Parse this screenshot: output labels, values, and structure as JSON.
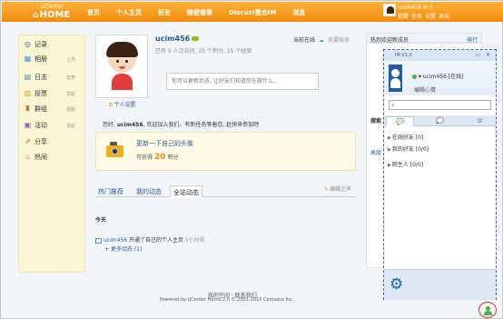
{
  "colors": {
    "accent": "#f08c0d",
    "link": "#2b5c9c",
    "im_blue": "#1e5ea8"
  },
  "logo": {
    "top": "UCenter",
    "home": "HOME"
  },
  "nav": [
    "首页",
    "个人主页",
    "好友",
    "随便看看",
    "Discuz!整合IM",
    "消息"
  ],
  "user_top": {
    "name": "ucim456",
    "badge": "✉ 3",
    "links": [
      "提醒",
      "任务",
      "设置",
      "退出"
    ]
  },
  "sidebar": [
    {
      "icon": "record-icon",
      "glyph": "◎",
      "label": "记录",
      "extra": ""
    },
    {
      "icon": "album-icon",
      "glyph": "▦",
      "label": "相册",
      "extra": "上传"
    },
    {
      "icon": "blog-icon",
      "glyph": "▤",
      "label": "日志",
      "extra": "发表"
    },
    {
      "icon": "poll-icon",
      "glyph": "▥",
      "label": "投票",
      "extra": "发起"
    },
    {
      "icon": "group-icon",
      "glyph": "♜",
      "label": "群组",
      "extra": "话题"
    },
    {
      "icon": "event-icon",
      "glyph": "▣",
      "label": "活动",
      "extra": "发起"
    },
    {
      "icon": "share-icon",
      "glyph": "⇗",
      "label": "分享",
      "extra": ""
    },
    {
      "icon": "hot-icon",
      "glyph": "♨",
      "label": "热闹",
      "extra": ""
    }
  ],
  "profile": {
    "username": "ucim456",
    "stats": "已有 0 人次访问, 25 个积分, 15 个经验",
    "settings_link": "个人设置",
    "online": "当前在线",
    "hide_label": "隐身",
    "hidden_label": "我要隐身",
    "status_placeholder": "你可以更新状态, 让好友们知道你在做什么...",
    "welcome_prefix": "您好, ",
    "welcome_user": "ucim456",
    "welcome_suffix": ", 欢迎加入我们。有新任务等着您, 赶快来参加吧"
  },
  "update_box": {
    "link": "更新一下自己的头像",
    "points_prefix": "可获得",
    "points": "20",
    "points_suffix": "积分"
  },
  "tabs": [
    "热门推荐",
    "我的动态",
    "全站动态"
  ],
  "edit_link": "编辑之声",
  "feed": {
    "day": "今天",
    "user": "ucim456",
    "action": " 开通了自己的个人主页 ",
    "time": "5小时前",
    "more": "更多动态 (1)"
  },
  "footer": {
    "line1": "我的空间 · 联系我们",
    "line2": "Powered by UCenter Home 2.0 © 2001-2010 Comsenz Inc."
  },
  "right": {
    "header": "热烈欢迎新成员",
    "header_link": "排行",
    "peek1": "搜索",
    "peek2": "高级"
  },
  "im": {
    "title": "IM V1.0",
    "controls": "▭ ✕",
    "user": "ucim456",
    "status": "[在线]",
    "signature": "编辑心情",
    "tabs": [
      "💬",
      "💭",
      "⚙"
    ],
    "groups": [
      "在线好友 [0]",
      "我的好友 [0/0]",
      "陌生人 [0/0]"
    ]
  }
}
